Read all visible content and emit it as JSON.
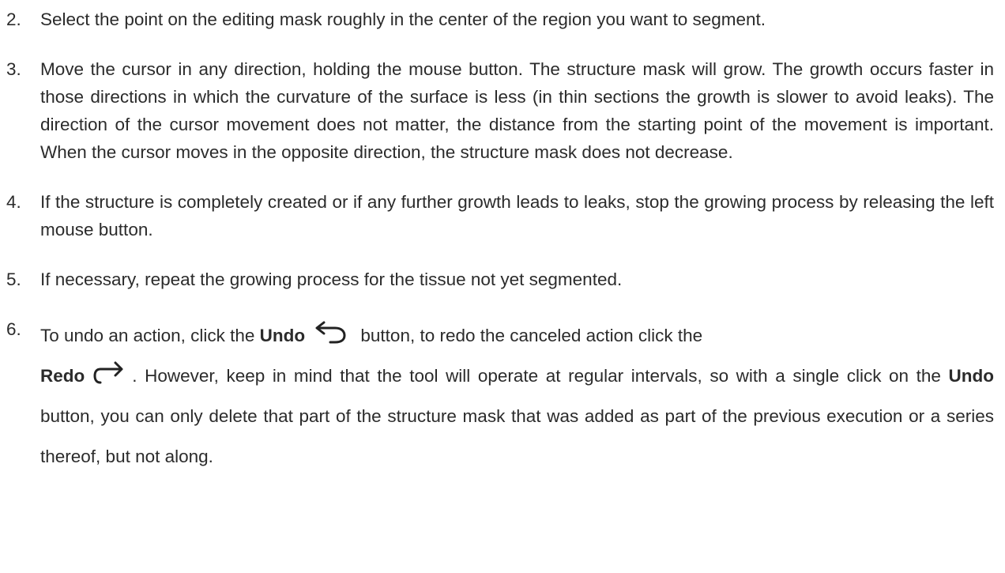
{
  "steps": [
    {
      "number": "2.",
      "text": "Select the point on the editing mask roughly in the center of the region you want to segment."
    },
    {
      "number": "3.",
      "text": "Move the cursor in any direction, holding the mouse button.  The structure mask will grow. The growth occurs faster in those directions in which the curvature of the surface is less (in thin sections the growth is slower to avoid leaks). The direction of the cursor movement does not matter, the distance from the starting point of the movement is important. When the cursor moves in the opposite direction, the structure mask does not decrease."
    },
    {
      "number": "4.",
      "text": "If the structure is completely created or if any further growth leads to leaks, stop the growing process by releasing the left mouse button."
    },
    {
      "number": "5.",
      "text": "If necessary, repeat the growing process for the tissue not yet segmented."
    },
    {
      "number": "6.",
      "part1": "To undo an action, click the ",
      "undo_label": "Undo",
      "undo_icon": "undo-icon",
      "part2": " button, to redo the canceled action click the",
      "redo_label": "Redo",
      "redo_icon": "redo-icon",
      "part3": ". However, keep in mind that the tool will operate at regular intervals, so with a single click on the ",
      "undo_label_2": "Undo",
      "part4": " button, you can only delete that part of the structure mask that was added as part of the previous execution or a series thereof, but not along."
    }
  ]
}
